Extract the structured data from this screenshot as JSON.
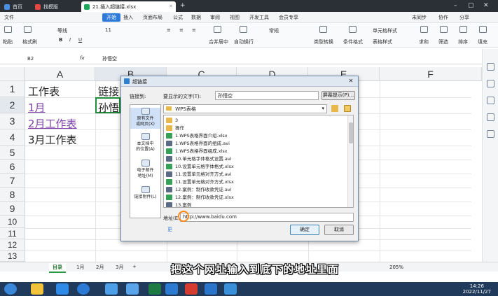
{
  "tabs": {
    "home": "首页",
    "template": "找模版",
    "doc": "21.插入超链接.xlsx"
  },
  "menu": [
    "文件",
    "开始",
    "插入",
    "页面布局",
    "公式",
    "数据",
    "审阅",
    "视图",
    "开发工具",
    "会员专享",
    "未同步",
    "协作",
    "分享"
  ],
  "toolbar": {
    "font_name": "等线",
    "font_size": "11",
    "paste": "粘贴",
    "format_brush": "格式刷",
    "merge": "合并居中",
    "wrap": "自动换行",
    "number_format": "常规",
    "type_convert": "类型转换",
    "cond_format": "条件格式",
    "table_style": "表格样式",
    "cell_style": "单元格样式",
    "sum": "求和",
    "filter": "筛选",
    "sort": "排序",
    "fill": "填充",
    "cell": "单元格",
    "rowcol": "行和列",
    "worksheet": "工作表"
  },
  "formula_bar": {
    "name_box": "B2",
    "fx": "fx",
    "content": "孙悟空"
  },
  "columns": [
    "A",
    "B",
    "C",
    "D",
    "E",
    "F"
  ],
  "rows": [
    "1",
    "2",
    "3",
    "4",
    "5",
    "6",
    "7",
    "8",
    "9",
    "10",
    "11",
    "12",
    "13"
  ],
  "cells": {
    "a1": "工作表",
    "b1": "链接",
    "a2": "1月",
    "b2": "孙悟",
    "a3": "2月工作表",
    "a4": "3月工作表"
  },
  "sheets": [
    "目录",
    "1月",
    "2月",
    "3月",
    "+"
  ],
  "caption": "把这个网址输入到底下的地址里面",
  "status": {
    "zoom": "205%"
  },
  "clock": {
    "time": "14:26",
    "date": "2022/11/27"
  },
  "dialog": {
    "title": "超链接",
    "link_to_label": "链接到:",
    "display_text_label": "要显示的文字(T):",
    "display_text_value": "孙悟空",
    "screen_tip": "屏幕提示(P)...",
    "folder": "WPS表格",
    "side_items": [
      "原有文件\n或网页(X)",
      "本文档中\n的位置(A)",
      "电子邮件\n地址(M)",
      "链接附件(L)"
    ],
    "files": [
      "3",
      "操作",
      "1.WPS表格界面介绍.xlsx",
      "1.WPS表格界面的组成.avi",
      "1.WPS表格界面组成.xlsx",
      "10.单元格字体格式设置.avi",
      "10.设置单元格字体格式.xlsx",
      "11.设置单元格对齐方式.avi",
      "11.设置单元格对齐方式.xlsx",
      "12.案例：制作收款凭证.avi",
      "12.案例：制作收款凭证.xlsx",
      "13.案例"
    ],
    "address_label": "地址(E):",
    "address_value": "http://www.baidu.com",
    "ok": "确定",
    "cancel": "取消",
    "more": "更"
  }
}
